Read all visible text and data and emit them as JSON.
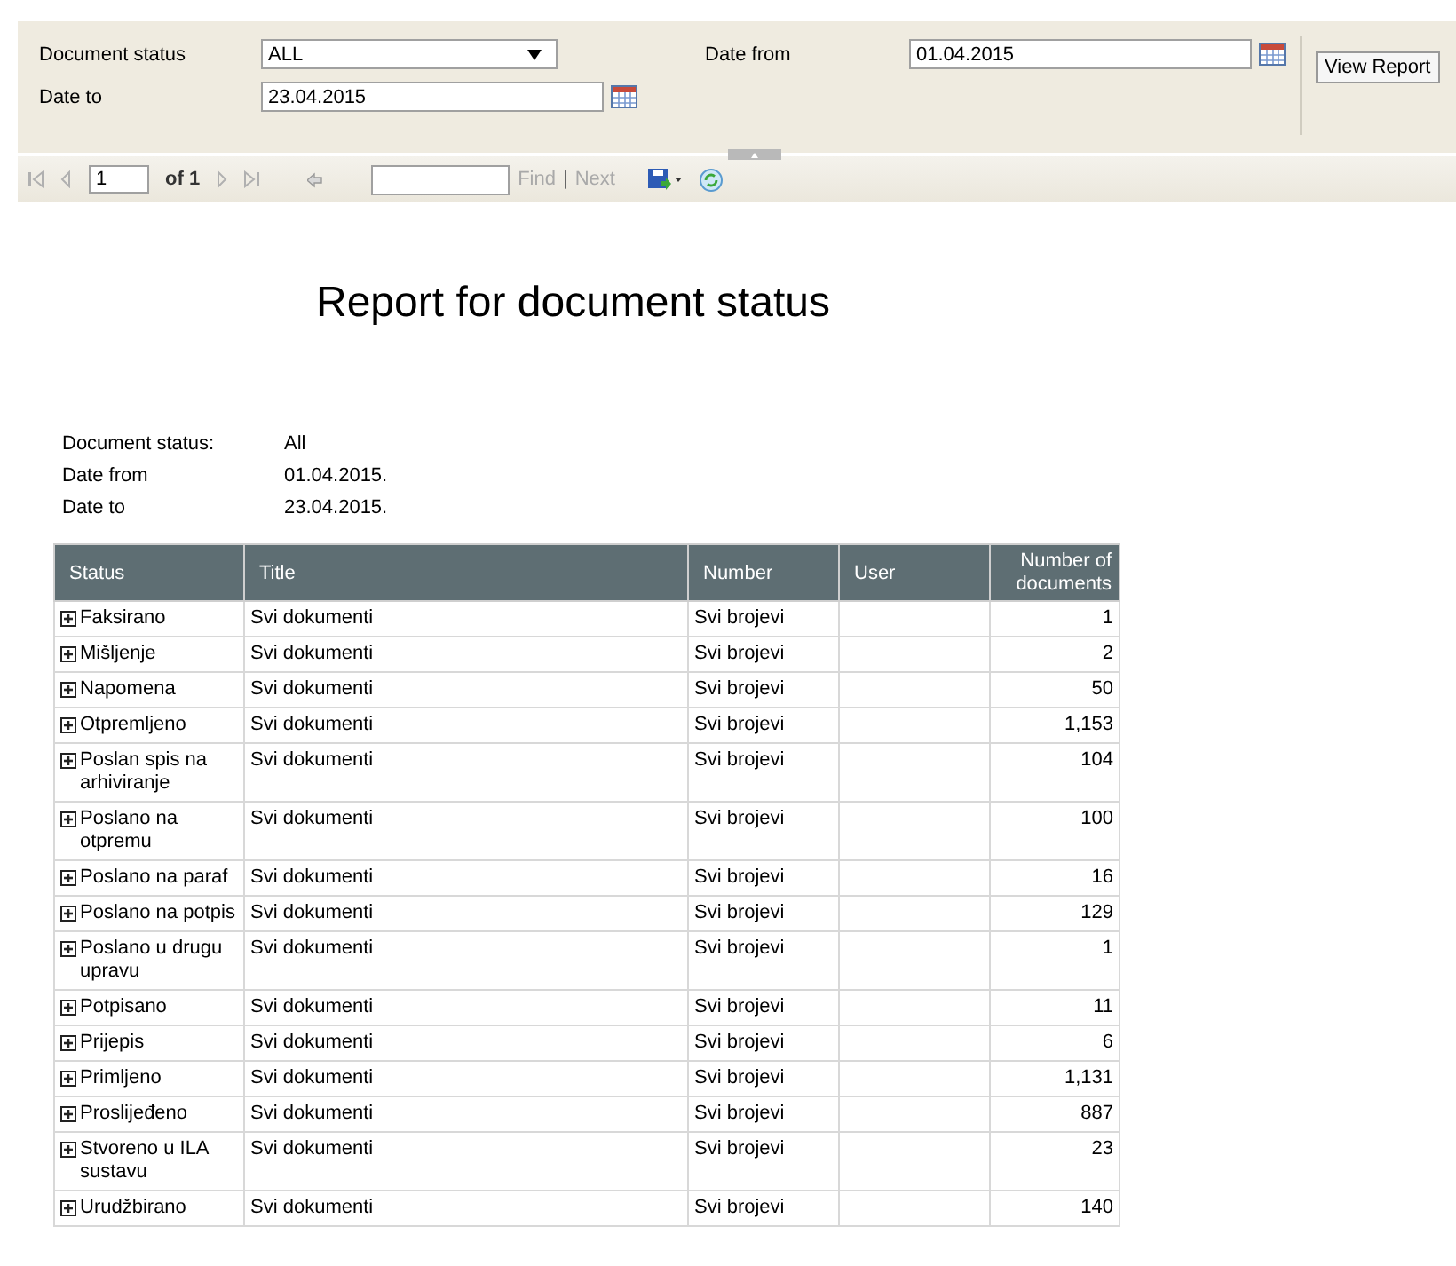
{
  "parameters": {
    "document_status": {
      "label": "Document status",
      "value": "ALL"
    },
    "date_from": {
      "label": "Date from",
      "value": "01.04.2015"
    },
    "date_to": {
      "label": "Date to",
      "value": "23.04.2015"
    },
    "view_report": "View Report"
  },
  "toolbar": {
    "first_disabled": true,
    "previous_disabled": true,
    "page": "1",
    "of_pages": "of 1",
    "next_disabled": true,
    "last_disabled": true,
    "find": {
      "label": "Find",
      "disabled": true
    },
    "separator": "|",
    "next": {
      "label": "Next",
      "disabled": true
    }
  },
  "report": {
    "title": "Report for document status",
    "info": [
      {
        "label": "Document status:",
        "value": "All"
      },
      {
        "label": "Date from",
        "value": "01.04.2015."
      },
      {
        "label": "Date to",
        "value": "23.04.2015."
      }
    ],
    "columns": [
      "Status",
      "Title",
      "Number",
      "User",
      "Number of documents"
    ],
    "rows": [
      {
        "status": "Faksirano",
        "expanded": false,
        "title": "Svi dokumenti",
        "number": "Svi brojevi",
        "count": "1"
      },
      {
        "status": "Mišljenje",
        "expanded": false,
        "title": "Svi dokumenti",
        "number": "Svi brojevi",
        "count": "2"
      },
      {
        "status": "Napomena",
        "expanded": false,
        "title": "Svi dokumenti",
        "number": "Svi brojevi",
        "count": "50"
      },
      {
        "status": "Otpremljeno",
        "expanded": false,
        "title": "Svi dokumenti",
        "number": "Svi brojevi",
        "count": "1,153"
      },
      {
        "status": "Poslan spis na arhiviranje",
        "expanded": false,
        "title": "Svi dokumenti",
        "number": "Svi brojevi",
        "count": "104"
      },
      {
        "status": "Poslano na otpremu",
        "expanded": false,
        "title": "Svi dokumenti",
        "number": "Svi brojevi",
        "count": "100"
      },
      {
        "status": "Poslano na paraf",
        "expanded": false,
        "title": "Svi dokumenti",
        "number": "Svi brojevi",
        "count": "16"
      },
      {
        "status": "Poslano na potpis",
        "expanded": false,
        "title": "Svi dokumenti",
        "number": "Svi brojevi",
        "count": "129"
      },
      {
        "status": "Poslano u drugu upravu",
        "expanded": false,
        "title": "Svi dokumenti",
        "number": "Svi brojevi",
        "count": "1"
      },
      {
        "status": "Potpisano",
        "expanded": false,
        "title": "Svi dokumenti",
        "number": "Svi brojevi",
        "count": "11"
      },
      {
        "status": "Prijepis",
        "expanded": false,
        "title": "Svi dokumenti",
        "number": "Svi brojevi",
        "count": "6"
      },
      {
        "status": "Primljeno",
        "expanded": false,
        "title": "Svi dokumenti",
        "number": "Svi brojevi",
        "count": "1,131"
      },
      {
        "status": "Proslijeđeno",
        "expanded": false,
        "title": "Svi dokumenti",
        "number": "Svi brojevi",
        "count": "887"
      },
      {
        "status": "Stvoreno u ILA sustavu",
        "expanded": false,
        "title": "Svi dokumenti",
        "number": "Svi brojevi",
        "count": "23"
      },
      {
        "status": "Urudžbirano",
        "expanded": false,
        "title": "Svi dokumenti",
        "number": "Svi brojevi",
        "count": "140"
      }
    ]
  }
}
